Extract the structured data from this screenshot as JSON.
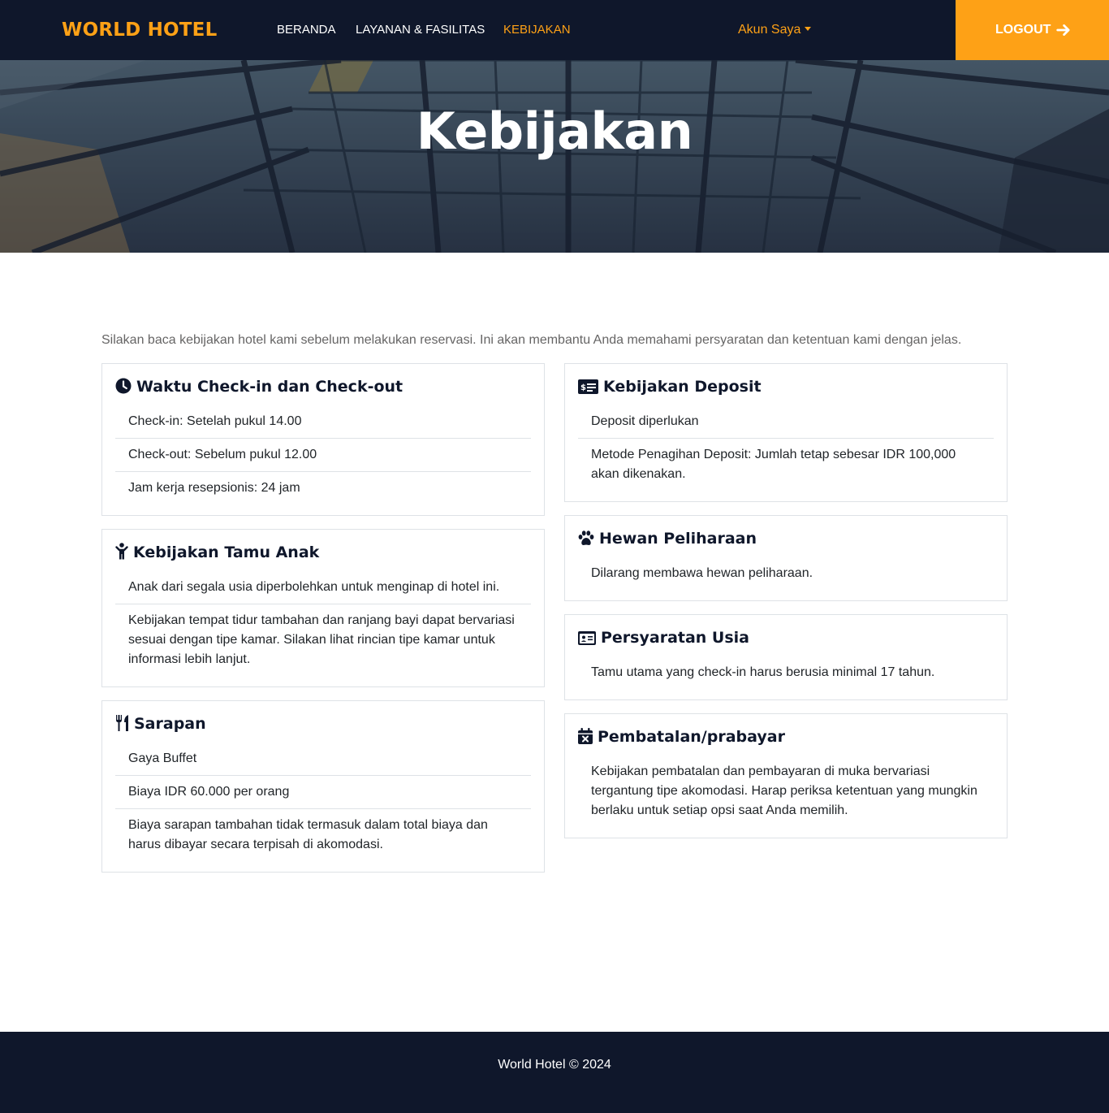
{
  "navbar": {
    "brand": "WORLD HOTEL",
    "links": [
      {
        "label": "BERANDA",
        "active": false
      },
      {
        "label": "LAYANAN & FASILITAS",
        "active": false
      },
      {
        "label": "KEBIJAKAN",
        "active": true
      }
    ],
    "account_label": "Akun Saya",
    "logout_label": "LOGOUT",
    "icons": {
      "account_caret": "caret-down-icon",
      "logout": "arrow-right-icon"
    }
  },
  "hero": {
    "title": "Kebijakan"
  },
  "intro": "Silakan baca kebijakan hotel kami sebelum melakukan reservasi. Ini akan membantu Anda memahami persyaratan dan ketentuan kami dengan jelas.",
  "policies": {
    "checkin": {
      "icon": "clock-icon",
      "title": "Waktu Check-in dan Check-out",
      "items": [
        "Check-in: Setelah pukul 14.00",
        "Check-out: Sebelum pukul 12.00",
        "Jam kerja resepsionis: 24 jam"
      ]
    },
    "anak": {
      "icon": "child-icon",
      "title": "Kebijakan Tamu Anak",
      "items": [
        "Anak dari segala usia diperbolehkan untuk menginap di hotel ini.",
        "Kebijakan tempat tidur tambahan dan ranjang bayi dapat bervariasi sesuai dengan tipe kamar. Silakan lihat rincian tipe kamar untuk informasi lebih lanjut."
      ]
    },
    "sarapan": {
      "icon": "utensils-icon",
      "title": "Sarapan",
      "items": [
        "Gaya Buffet",
        "Biaya IDR 60.000 per orang",
        "Biaya sarapan tambahan tidak termasuk dalam total biaya dan harus dibayar secara terpisah di akomodasi."
      ]
    },
    "deposit": {
      "icon": "money-check-icon",
      "title": "Kebijakan Deposit",
      "items": [
        "Deposit diperlukan",
        "Metode Penagihan Deposit: Jumlah tetap sebesar IDR 100,000 akan dikenakan."
      ]
    },
    "hewan": {
      "icon": "paw-icon",
      "title": "Hewan Peliharaan",
      "items": [
        "Dilarang membawa hewan peliharaan."
      ]
    },
    "usia": {
      "icon": "id-card-icon",
      "title": "Persyaratan Usia",
      "items": [
        "Tamu utama yang check-in harus berusia minimal 17 tahun."
      ]
    },
    "batal": {
      "icon": "calendar-x-icon",
      "title": "Pembatalan/prabayar",
      "items": [
        "Kebijakan pembatalan dan pembayaran di muka bervariasi tergantung tipe akomodasi. Harap periksa ketentuan yang mungkin berlaku untuk setiap opsi saat Anda memilih."
      ]
    }
  },
  "footer": {
    "text": "World Hotel © 2024"
  },
  "colors": {
    "navy": "#0f172b",
    "accent": "#fea116",
    "border": "#dee2e6",
    "muted_text": "#666565"
  }
}
